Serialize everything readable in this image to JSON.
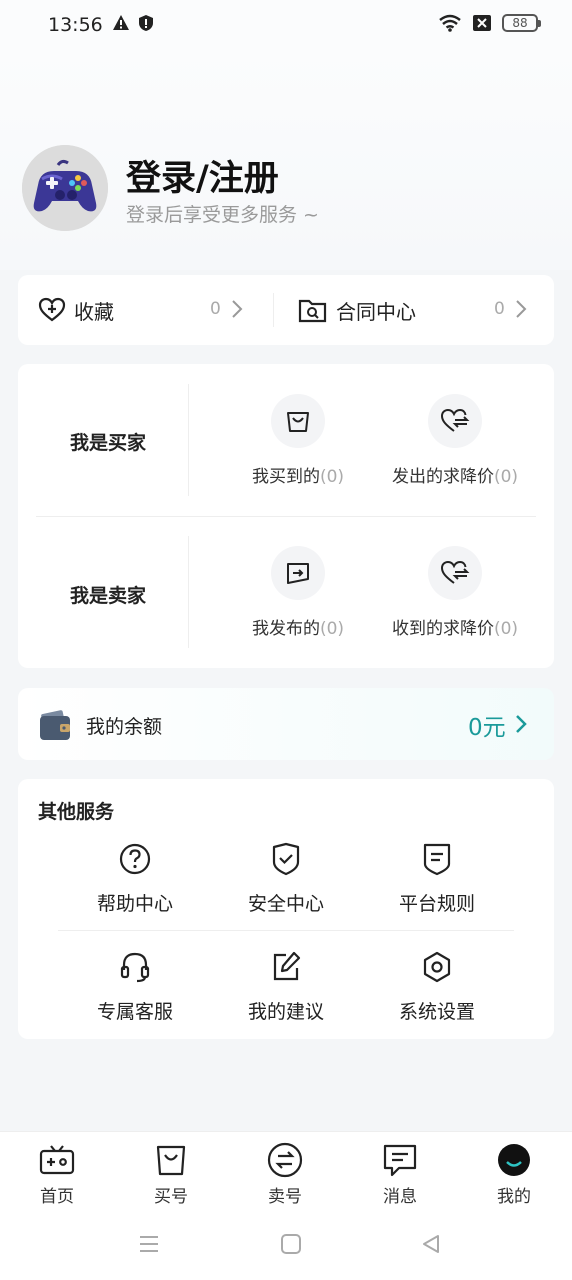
{
  "status_bar": {
    "time": "13:56",
    "battery": "88"
  },
  "profile": {
    "title": "登录/注册",
    "subtitle": "登录后享受更多服务 ~"
  },
  "favorites": [
    {
      "label": "收藏",
      "count": "0",
      "icon": "heart-plus-icon"
    },
    {
      "label": "合同中心",
      "count": "0",
      "icon": "folder-search-icon"
    }
  ],
  "buyer": {
    "label": "我是买家",
    "items": [
      {
        "label": "我买到的",
        "count": "(0)",
        "icon": "shopping-bag-icon"
      },
      {
        "label": "发出的求降价",
        "count": "(0)",
        "icon": "heart-exchange-icon"
      }
    ]
  },
  "seller": {
    "label": "我是卖家",
    "items": [
      {
        "label": "我发布的",
        "count": "(0)",
        "icon": "publish-icon"
      },
      {
        "label": "收到的求降价",
        "count": "(0)",
        "icon": "heart-exchange-icon"
      }
    ]
  },
  "balance": {
    "label": "我的余额",
    "value": "0元",
    "icon": "wallet-icon",
    "accent": "#1a9a9a"
  },
  "services": {
    "title": "其他服务",
    "items": [
      {
        "label": "帮助中心",
        "icon": "help-circle-icon"
      },
      {
        "label": "安全中心",
        "icon": "shield-check-icon"
      },
      {
        "label": "平台规则",
        "icon": "rules-icon"
      },
      {
        "label": "专属客服",
        "icon": "headset-icon"
      },
      {
        "label": "我的建议",
        "icon": "edit-icon"
      },
      {
        "label": "系统设置",
        "icon": "settings-icon"
      }
    ]
  },
  "tabs": [
    {
      "label": "首页",
      "icon": "game-console-icon"
    },
    {
      "label": "买号",
      "icon": "shopping-bag-icon"
    },
    {
      "label": "卖号",
      "icon": "exchange-circle-icon"
    },
    {
      "label": "消息",
      "icon": "message-icon"
    },
    {
      "label": "我的",
      "icon": "profile-face-icon",
      "active": true
    }
  ]
}
